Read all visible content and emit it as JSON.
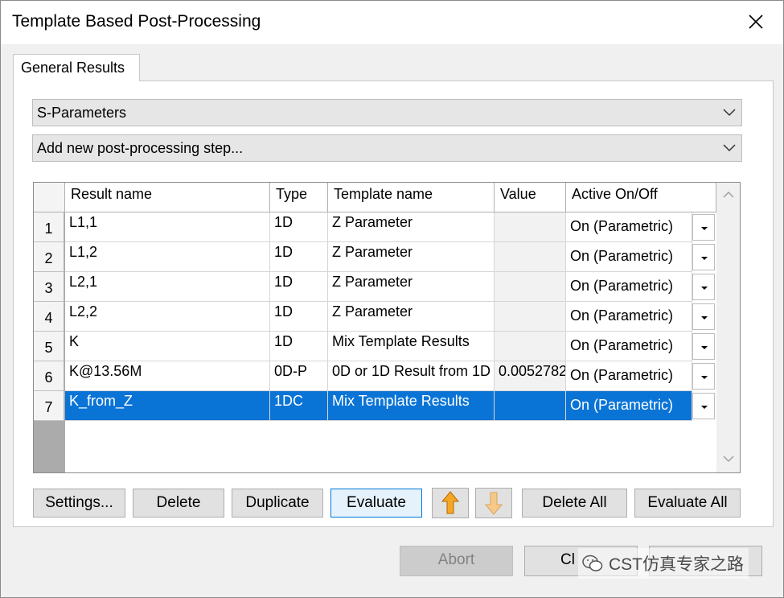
{
  "window": {
    "title": "Template Based Post-Processing"
  },
  "tabs": [
    {
      "label": "General Results"
    }
  ],
  "result_type_select": {
    "value": "S-Parameters"
  },
  "step_select": {
    "value": "Add new post-processing step..."
  },
  "table": {
    "columns": [
      "Result name",
      "Type",
      "Template name",
      "Value",
      "Active On/Off"
    ],
    "rows": [
      {
        "num": "1",
        "name": "L1,1",
        "type": "1D",
        "template": "Z Parameter",
        "value": "",
        "active": "On (Parametric)"
      },
      {
        "num": "2",
        "name": "L1,2",
        "type": "1D",
        "template": "Z Parameter",
        "value": "",
        "active": "On (Parametric)"
      },
      {
        "num": "3",
        "name": "L2,1",
        "type": "1D",
        "template": "Z Parameter",
        "value": "",
        "active": "On (Parametric)"
      },
      {
        "num": "4",
        "name": "L2,2",
        "type": "1D",
        "template": "Z Parameter",
        "value": "",
        "active": "On (Parametric)"
      },
      {
        "num": "5",
        "name": "K",
        "type": "1D",
        "template": "Mix Template Results",
        "value": "",
        "active": "On (Parametric)"
      },
      {
        "num": "6",
        "name": "K@13.56M",
        "type": "0D-P",
        "template": "0D or 1D Result from 1D",
        "value": "0.0052782",
        "active": "On (Parametric)"
      },
      {
        "num": "7",
        "name": "K_from_Z",
        "type": "1DC",
        "template": "Mix Template Results",
        "value": "",
        "active": "On (Parametric)"
      }
    ],
    "selected_row": 7
  },
  "buttons": {
    "settings": "Settings...",
    "delete": "Delete",
    "duplicate": "Duplicate",
    "evaluate": "Evaluate",
    "delete_all": "Delete All",
    "evaluate_all": "Evaluate All",
    "abort": "Abort",
    "close": "Cl"
  },
  "watermark": {
    "text": "CST仿真专家之路"
  },
  "colors": {
    "selection": "#0a74d6",
    "arrow_up": "#f5a623",
    "arrow_down_disabled": "#f6c98a"
  }
}
